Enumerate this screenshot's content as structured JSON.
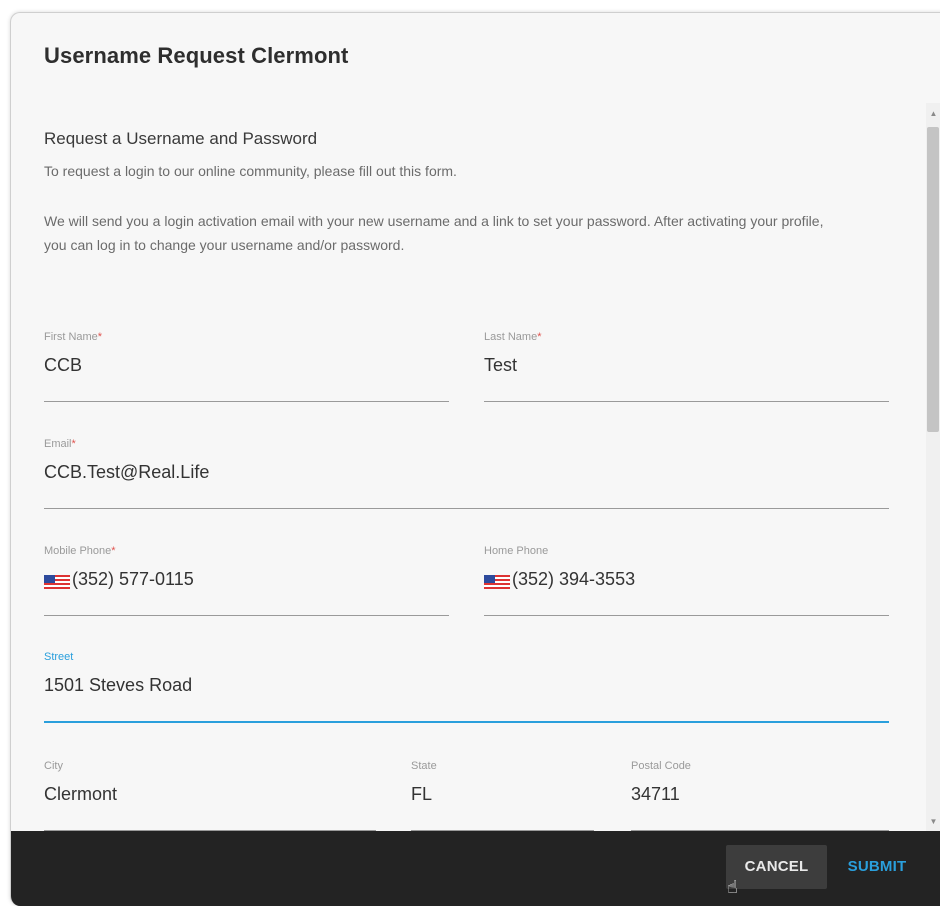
{
  "dialog": {
    "title": "Username Request Clermont"
  },
  "intro": {
    "heading": "Request a Username and Password",
    "line1": "To request a login to our online community, please fill out this form.",
    "line2": "We will send you a login activation email with your new username and a link to set your password. After activating your profile, you can log in to change your username and/or password."
  },
  "form": {
    "first_name": {
      "label": "First Name",
      "required_mark": "*",
      "value": "CCB"
    },
    "last_name": {
      "label": "Last Name",
      "required_mark": "*",
      "value": "Test"
    },
    "email": {
      "label": "Email",
      "required_mark": "*",
      "value": "CCB.Test@Real.Life"
    },
    "mobile_phone": {
      "label": "Mobile Phone",
      "required_mark": "*",
      "value": "(352) 577-0115",
      "flag_icon": "us-flag-icon"
    },
    "home_phone": {
      "label": "Home Phone",
      "value": "(352) 394-3553",
      "flag_icon": "us-flag-icon"
    },
    "street": {
      "label": "Street",
      "value": "1501 Steves Road"
    },
    "city": {
      "label": "City",
      "value": "Clermont"
    },
    "state": {
      "label": "State",
      "value": "FL"
    },
    "postal_code": {
      "label": "Postal Code",
      "value": "34711"
    }
  },
  "footer": {
    "cancel_label": "CANCEL",
    "submit_label": "SUBMIT"
  },
  "colors": {
    "accent": "#2a9fdc",
    "required": "#e0544f",
    "footer_bg": "#232323"
  },
  "scrollbar": {
    "up_icon": "scroll-up-arrow-icon",
    "down_icon": "scroll-down-arrow-icon"
  }
}
